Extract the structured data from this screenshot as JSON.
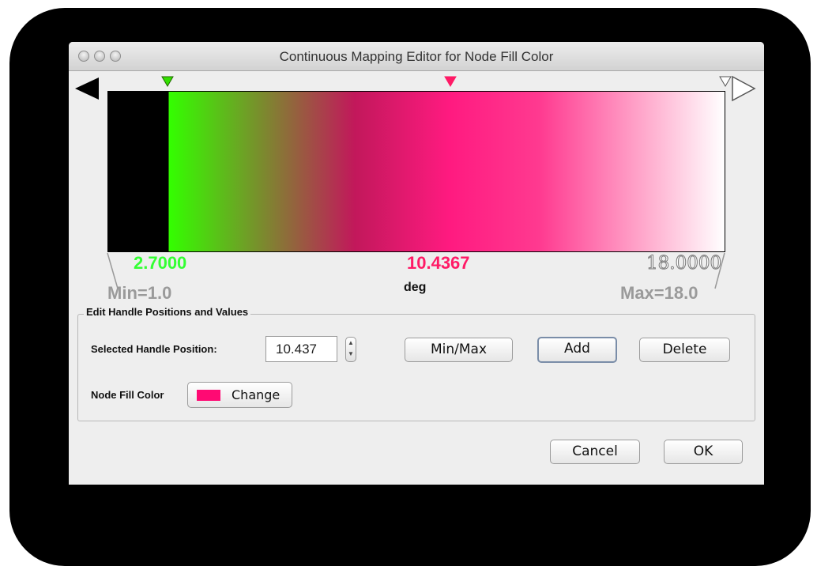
{
  "window": {
    "title": "Continuous Mapping Editor for Node Fill Color"
  },
  "editor": {
    "attribute_name": "deg",
    "min_label": "Min=1.0",
    "max_label": "Max=18.0",
    "handles": [
      {
        "value_label": "2.7000",
        "color": "#33ff00"
      },
      {
        "value_label": "10.4367",
        "color": "#ff1a66"
      },
      {
        "value_label": "18.0000",
        "color": "#ffffff"
      }
    ],
    "below_range_color": "#000000",
    "above_range_color": "#ffffff"
  },
  "group": {
    "title": "Edit Handle Positions and Values",
    "position_label": "Selected Handle Position:",
    "position_value": "10.437",
    "minmax_button": "Min/Max",
    "add_button": "Add",
    "delete_button": "Delete",
    "color_label": "Node Fill Color",
    "change_button": "Change",
    "selected_color": "#ff0a73"
  },
  "dialog": {
    "cancel_button": "Cancel",
    "ok_button": "OK"
  }
}
